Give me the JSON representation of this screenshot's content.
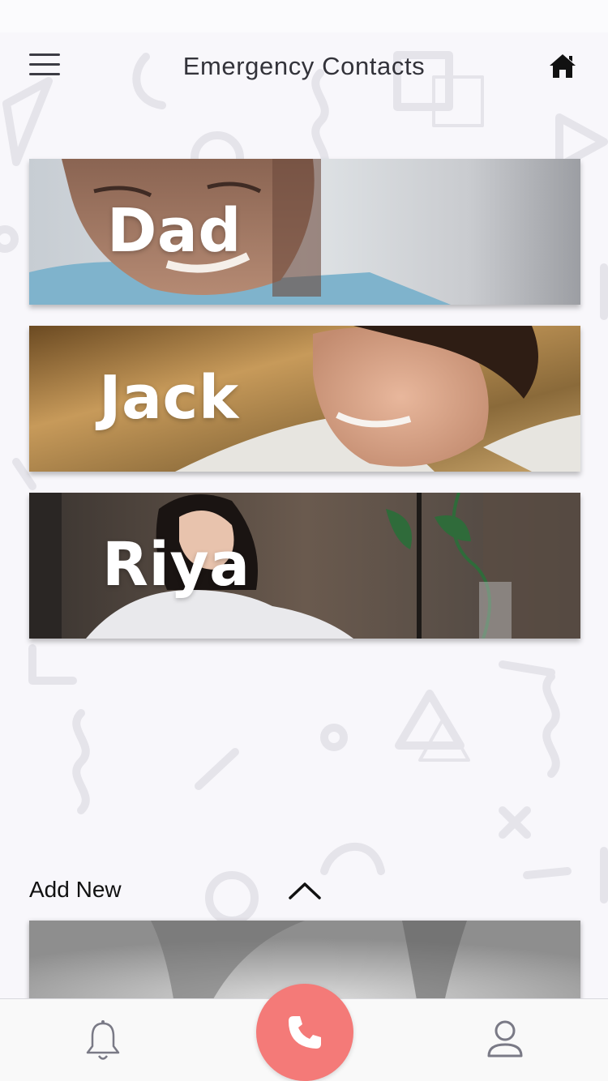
{
  "header": {
    "title": "Emergency Contacts",
    "menu_icon": "hamburger-menu-icon",
    "home_icon": "home-icon"
  },
  "contacts": [
    {
      "name": "Dad"
    },
    {
      "name": "Jack"
    },
    {
      "name": "Riya"
    }
  ],
  "add_new": {
    "label": "Add New",
    "toggle_icon": "chevron-up-icon"
  },
  "bottom_nav": {
    "left_icon": "bell-icon",
    "center_icon": "phone-icon",
    "right_icon": "user-icon"
  },
  "colors": {
    "accent": "#f47a78",
    "title": "#33333a",
    "background": "#f8f7fb"
  }
}
